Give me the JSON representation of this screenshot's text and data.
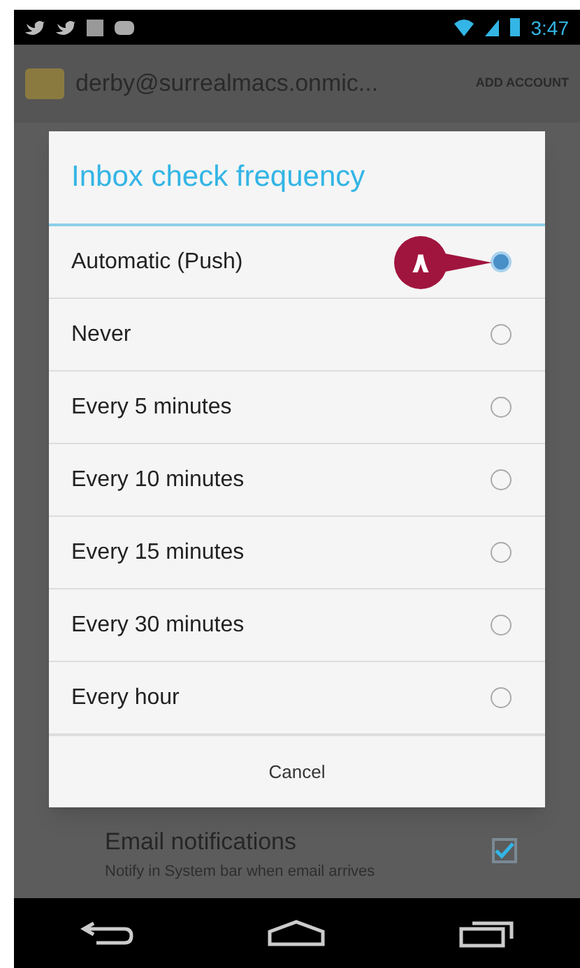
{
  "status_bar": {
    "time": "3:47"
  },
  "action_bar": {
    "account": "derby@surrealmacs.onmic...",
    "action": "ADD ACCOUNT"
  },
  "dialog": {
    "title": "Inbox check frequency",
    "options": [
      {
        "label": "Automatic (Push)",
        "selected": true
      },
      {
        "label": "Never",
        "selected": false
      },
      {
        "label": "Every 5 minutes",
        "selected": false
      },
      {
        "label": "Every 10 minutes",
        "selected": false
      },
      {
        "label": "Every 15 minutes",
        "selected": false
      },
      {
        "label": "Every 30 minutes",
        "selected": false
      },
      {
        "label": "Every hour",
        "selected": false
      }
    ],
    "cancel": "Cancel"
  },
  "callout": {
    "label": "٨"
  },
  "setting": {
    "title": "Email notifications",
    "summary": "Notify in System bar when email arrives",
    "checked": true
  }
}
